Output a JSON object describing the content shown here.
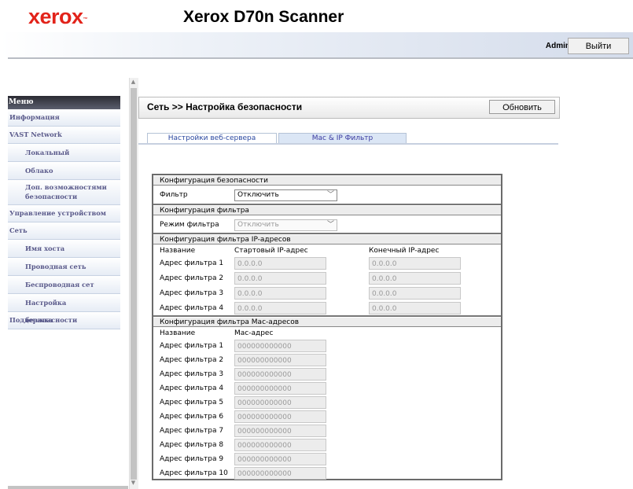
{
  "header": {
    "logo": "xerox",
    "logo_tm": "™",
    "product": "Xerox D70n Scanner",
    "user": "Admin",
    "logout_label": "Выйти"
  },
  "menu": {
    "title": "Меню",
    "items": [
      {
        "label": "Информация"
      },
      {
        "label": "VAST Network"
      },
      {
        "label": "Локальный"
      },
      {
        "label": "Облако"
      },
      {
        "label": "Доп. возможностями безопасности"
      },
      {
        "label": "Управление устройством"
      },
      {
        "label": "Сеть"
      },
      {
        "label": "Имя хоста"
      },
      {
        "label": "Проводная сеть"
      },
      {
        "label": "Беспроводная сет"
      },
      {
        "label": "Настройка безопасности"
      },
      {
        "label": "Поддержка"
      }
    ]
  },
  "page": {
    "title": "Сеть >> Настройка безопасности",
    "refresh_label": "Обновить",
    "tabs": [
      {
        "label": "Настройки веб-сервера"
      },
      {
        "label": "Mac & IP Фильтр"
      }
    ]
  },
  "security": {
    "header": "Конфигурация безопасности",
    "filter_label": "Фильтр",
    "filter_value": "Отключить"
  },
  "filter_config": {
    "header": "Конфигурация фильтра",
    "mode_label": "Режим фильтра",
    "mode_value": "Отключить"
  },
  "ip_filter": {
    "header": "Конфигурация фильтра IP-адресов",
    "col_name": "Название",
    "col_start": "Стартовый IP-адрес",
    "col_end": "Конечный IP-адрес",
    "rows": [
      {
        "label": "Адрес фильтра 1",
        "start": "0.0.0.0",
        "end": "0.0.0.0"
      },
      {
        "label": "Адрес фильтра 2",
        "start": "0.0.0.0",
        "end": "0.0.0.0"
      },
      {
        "label": "Адрес фильтра 3",
        "start": "0.0.0.0",
        "end": "0.0.0.0"
      },
      {
        "label": "Адрес фильтра 4",
        "start": "0.0.0.0",
        "end": "0.0.0.0"
      }
    ]
  },
  "mac_filter": {
    "header": "Конфигурация фильтра Mac-адресов",
    "col_name": "Название",
    "col_mac": "Mac-адрес",
    "rows": [
      {
        "label": "Адрес фильтра 1",
        "mac": "000000000000"
      },
      {
        "label": "Адрес фильтра 2",
        "mac": "000000000000"
      },
      {
        "label": "Адрес фильтра 3",
        "mac": "000000000000"
      },
      {
        "label": "Адрес фильтра 4",
        "mac": "000000000000"
      },
      {
        "label": "Адрес фильтра 5",
        "mac": "000000000000"
      },
      {
        "label": "Адрес фильтра 6",
        "mac": "000000000000"
      },
      {
        "label": "Адрес фильтра 7",
        "mac": "000000000000"
      },
      {
        "label": "Адрес фильтра 8",
        "mac": "000000000000"
      },
      {
        "label": "Адрес фильтра 9",
        "mac": "000000000000"
      },
      {
        "label": "Адрес фильтра 10",
        "mac": "000000000000"
      }
    ]
  }
}
